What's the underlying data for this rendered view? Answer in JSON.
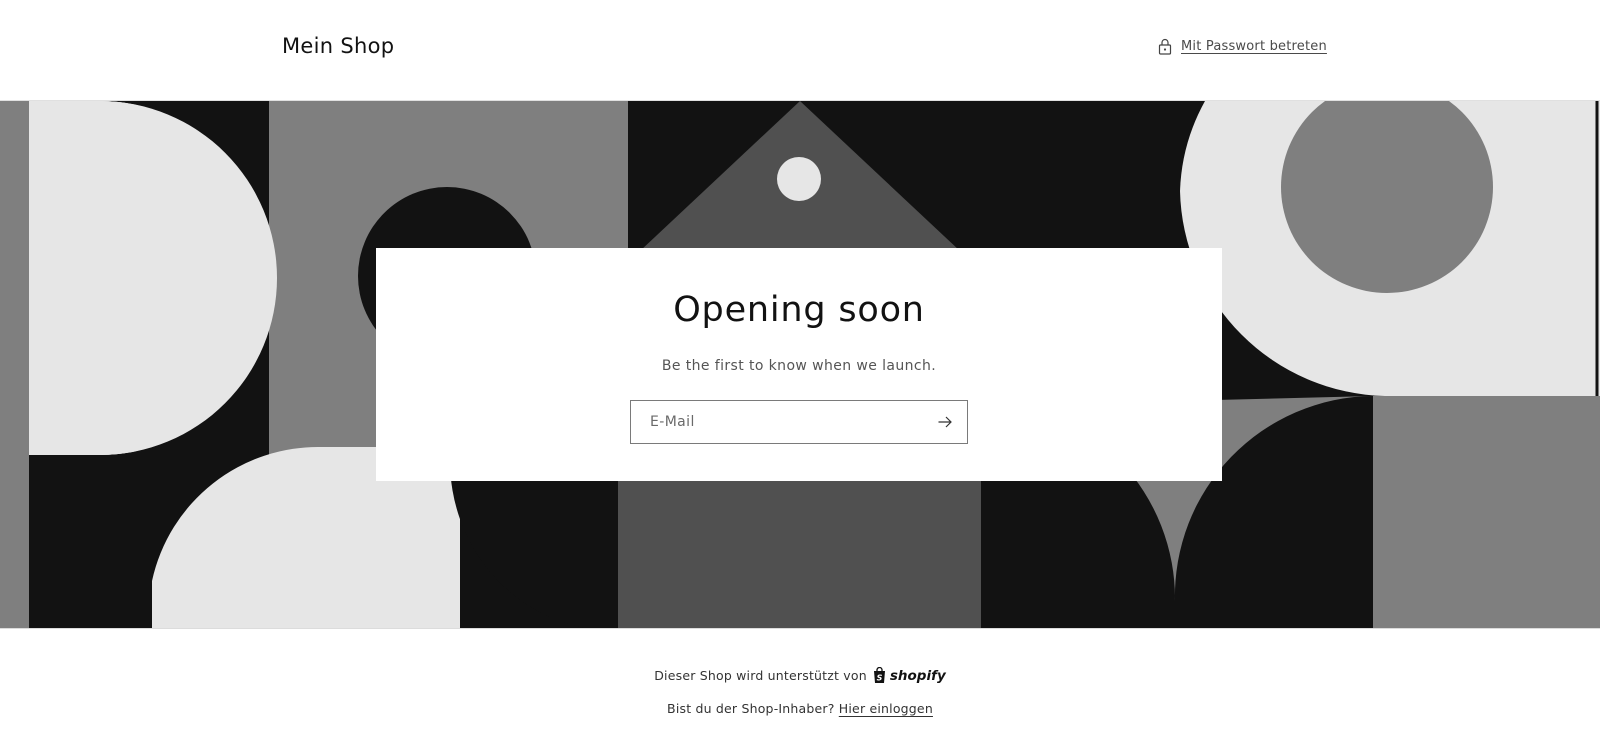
{
  "header": {
    "shop_name": "Mein Shop",
    "password_link": "Mit Passwort betreten"
  },
  "banner": {
    "card": {
      "title": "Opening soon",
      "subtitle": "Be the first to know when we launch.",
      "email_placeholder": "E-Mail"
    }
  },
  "footer": {
    "powered_by": "Dieser Shop wird unterstützt von",
    "shopify_logo": "shopify",
    "owner_question": "Bist du der Shop-Inhaber?",
    "login_link": "Hier einloggen"
  },
  "icons": {
    "lock": "lock-icon",
    "arrow": "arrow-right-icon",
    "shopify_bag": "shopify-bag-icon"
  },
  "colors": {
    "dark": "#121212",
    "mid_gray": "#7f7f7f",
    "dark_gray": "#505050",
    "light_gray": "#e6e6e6",
    "white": "#ffffff"
  }
}
